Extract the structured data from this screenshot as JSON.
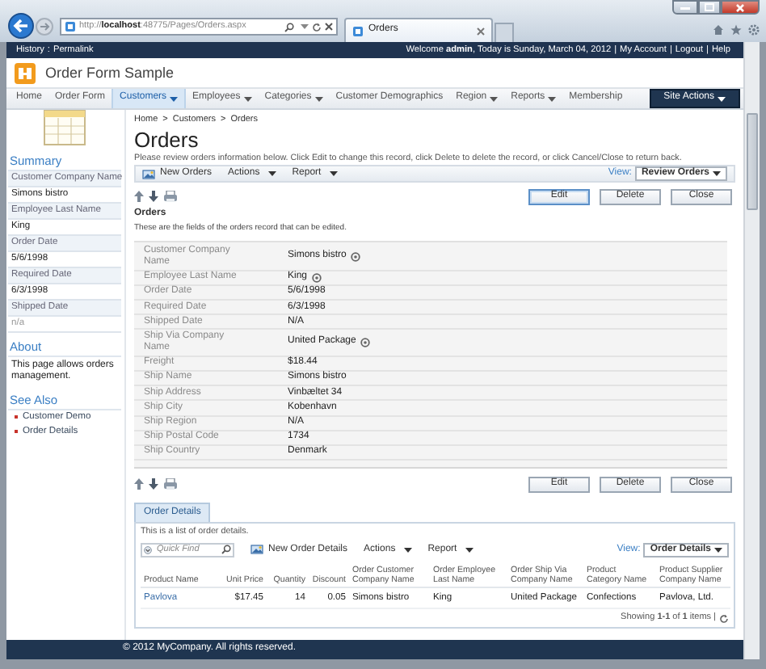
{
  "browser": {
    "url": "http://**localhost**:48775/Pages/Orders.aspx",
    "tab_title": "Orders"
  },
  "top_bar": {
    "left_links": [
      "History",
      "Permalink"
    ],
    "left_separator": ":",
    "greeting": "Welcome **admin**, Today is Sunday, March 04, 2012",
    "right_separator": "|",
    "right_links": [
      "My Account",
      "Logout",
      "Help"
    ]
  },
  "app_title": "Order Form Sample",
  "menu": {
    "items": [
      {
        "label": "Home",
        "dropdown": false,
        "selected": false
      },
      {
        "label": "Order Form",
        "dropdown": false,
        "selected": false
      },
      {
        "label": "Customers",
        "dropdown": true,
        "selected": true
      },
      {
        "label": "Employees",
        "dropdown": true,
        "selected": false
      },
      {
        "label": "Categories",
        "dropdown": true,
        "selected": false
      },
      {
        "label": "Customer Demographics",
        "dropdown": false,
        "selected": false
      },
      {
        "label": "Region",
        "dropdown": true,
        "selected": false
      },
      {
        "label": "Reports",
        "dropdown": true,
        "selected": false
      },
      {
        "label": "Membership",
        "dropdown": false,
        "selected": false
      }
    ],
    "site_actions": "Site Actions"
  },
  "sidebar": {
    "summary": {
      "heading": "Summary",
      "fields": [
        {
          "label": "Customer Company Name",
          "value": "Simons bistro",
          "empty": false
        },
        {
          "label": "Employee Last Name",
          "value": "King",
          "empty": false
        },
        {
          "label": "Order Date",
          "value": "5/6/1998",
          "empty": false
        },
        {
          "label": "Required Date",
          "value": "6/3/1998",
          "empty": false
        },
        {
          "label": "Shipped Date",
          "value": "n/a",
          "empty": true
        }
      ]
    },
    "about": {
      "heading": "About",
      "text": "This page allows orders management."
    },
    "see_also": {
      "heading": "See Also",
      "links": [
        "Customer Demo",
        "Order Details"
      ]
    }
  },
  "record": {
    "breadcrumb": [
      "Home",
      "Customers",
      "Orders"
    ],
    "breadcrumb_separator": ">",
    "title": "Orders",
    "description": "Please review orders information below. Click Edit to change this record, click Delete to delete the record, or click Cancel/Close to return back.",
    "toolbar": [
      {
        "label": "New Orders",
        "kind": "new"
      },
      {
        "label": "Actions",
        "kind": "menu"
      },
      {
        "label": "Report",
        "kind": "menu"
      }
    ],
    "view_label": "View:",
    "view_value": "Review Orders",
    "buttons": [
      {
        "label": "Edit",
        "default": true
      },
      {
        "label": "Delete",
        "default": false
      },
      {
        "label": "Close",
        "default": false
      }
    ],
    "form_heading": "Orders",
    "form_subtitle": "These are the fields of the orders record that can be edited.",
    "fields": [
      {
        "label": "Customer Company Name",
        "value": "Simons bistro",
        "lookup": true
      },
      {
        "label": "Employee Last Name",
        "value": "King",
        "lookup": true
      },
      {
        "label": "Order Date",
        "value": "5/6/1998",
        "lookup": false
      },
      {
        "label": "Required Date",
        "value": "6/3/1998",
        "lookup": false
      },
      {
        "label": "Shipped Date",
        "value": "N/A",
        "lookup": false
      },
      {
        "label": "Ship Via Company Name",
        "value": "United Package",
        "lookup": true
      },
      {
        "label": "Freight",
        "value": "$18.44",
        "lookup": false
      },
      {
        "label": "Ship Name",
        "value": "Simons bistro",
        "lookup": false
      },
      {
        "label": "Ship Address",
        "value": "Vinbæltet 34",
        "lookup": false
      },
      {
        "label": "Ship City",
        "value": "Kobenhavn",
        "lookup": false
      },
      {
        "label": "Ship Region",
        "value": "N/A",
        "lookup": false
      },
      {
        "label": "Ship Postal Code",
        "value": "1734",
        "lookup": false
      },
      {
        "label": "Ship Country",
        "value": "Denmark",
        "lookup": false
      }
    ],
    "bottom_buttons": [
      {
        "label": "Edit",
        "default": false
      },
      {
        "label": "Delete",
        "default": false
      },
      {
        "label": "Close",
        "default": false
      }
    ]
  },
  "details": {
    "tab": {
      "label": "Order Details",
      "selected": true
    },
    "description": "This is a list of order details.",
    "quick_find": {
      "placeholder": "Quick Find"
    },
    "toolbar": [
      {
        "label": "New Order Details",
        "kind": "new"
      },
      {
        "label": "Actions",
        "kind": "menu"
      },
      {
        "label": "Report",
        "kind": "menu"
      }
    ],
    "view_label": "View:",
    "view_value": "Order Details",
    "columns": [
      {
        "label": "Product Name",
        "numeric": false
      },
      {
        "label": "Unit Price",
        "numeric": true
      },
      {
        "label": "Quantity",
        "numeric": true
      },
      {
        "label": "Discount",
        "numeric": true
      },
      {
        "label": "Order Customer Company Name",
        "numeric": false
      },
      {
        "label": "Order Employee Last Name",
        "numeric": false
      },
      {
        "label": "Order Ship Via Company Name",
        "numeric": false
      },
      {
        "label": "Product Category Name",
        "numeric": false
      },
      {
        "label": "Product Supplier Company Name",
        "numeric": false
      }
    ],
    "rows": [
      {
        "cells": [
          "Pavlova",
          "$17.45",
          "14",
          "0.05",
          "Simons bistro",
          "King",
          "United Package",
          "Confections",
          "Pavlova, Ltd."
        ]
      }
    ],
    "pager": "Showing **1-1** of **1** items |"
  },
  "footer": "© 2012 MyCompany. All rights reserved."
}
